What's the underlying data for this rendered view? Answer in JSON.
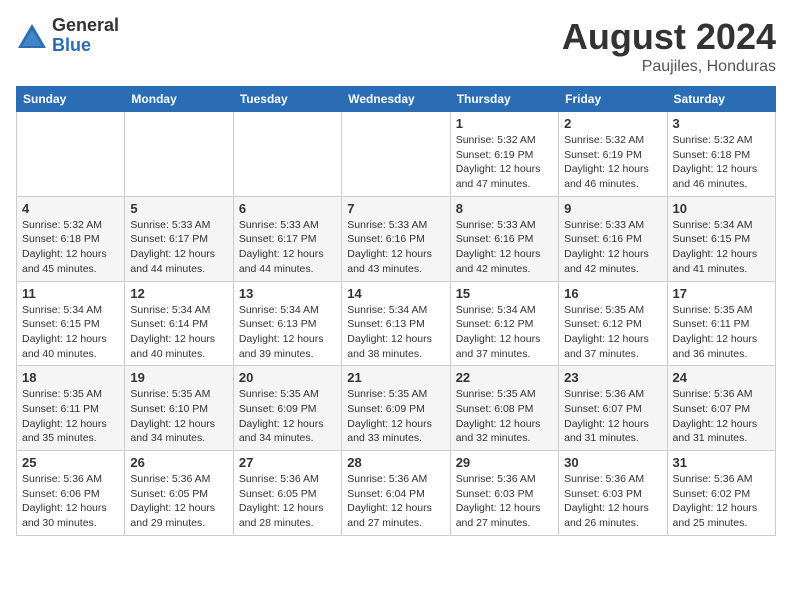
{
  "logo": {
    "general": "General",
    "blue": "Blue"
  },
  "title": {
    "month": "August 2024",
    "location": "Paujiles, Honduras"
  },
  "weekdays": [
    "Sunday",
    "Monday",
    "Tuesday",
    "Wednesday",
    "Thursday",
    "Friday",
    "Saturday"
  ],
  "weeks": [
    [
      {
        "day": "",
        "info": ""
      },
      {
        "day": "",
        "info": ""
      },
      {
        "day": "",
        "info": ""
      },
      {
        "day": "",
        "info": ""
      },
      {
        "day": "1",
        "info": "Sunrise: 5:32 AM\nSunset: 6:19 PM\nDaylight: 12 hours\nand 47 minutes."
      },
      {
        "day": "2",
        "info": "Sunrise: 5:32 AM\nSunset: 6:19 PM\nDaylight: 12 hours\nand 46 minutes."
      },
      {
        "day": "3",
        "info": "Sunrise: 5:32 AM\nSunset: 6:18 PM\nDaylight: 12 hours\nand 46 minutes."
      }
    ],
    [
      {
        "day": "4",
        "info": "Sunrise: 5:32 AM\nSunset: 6:18 PM\nDaylight: 12 hours\nand 45 minutes."
      },
      {
        "day": "5",
        "info": "Sunrise: 5:33 AM\nSunset: 6:17 PM\nDaylight: 12 hours\nand 44 minutes."
      },
      {
        "day": "6",
        "info": "Sunrise: 5:33 AM\nSunset: 6:17 PM\nDaylight: 12 hours\nand 44 minutes."
      },
      {
        "day": "7",
        "info": "Sunrise: 5:33 AM\nSunset: 6:16 PM\nDaylight: 12 hours\nand 43 minutes."
      },
      {
        "day": "8",
        "info": "Sunrise: 5:33 AM\nSunset: 6:16 PM\nDaylight: 12 hours\nand 42 minutes."
      },
      {
        "day": "9",
        "info": "Sunrise: 5:33 AM\nSunset: 6:16 PM\nDaylight: 12 hours\nand 42 minutes."
      },
      {
        "day": "10",
        "info": "Sunrise: 5:34 AM\nSunset: 6:15 PM\nDaylight: 12 hours\nand 41 minutes."
      }
    ],
    [
      {
        "day": "11",
        "info": "Sunrise: 5:34 AM\nSunset: 6:15 PM\nDaylight: 12 hours\nand 40 minutes."
      },
      {
        "day": "12",
        "info": "Sunrise: 5:34 AM\nSunset: 6:14 PM\nDaylight: 12 hours\nand 40 minutes."
      },
      {
        "day": "13",
        "info": "Sunrise: 5:34 AM\nSunset: 6:13 PM\nDaylight: 12 hours\nand 39 minutes."
      },
      {
        "day": "14",
        "info": "Sunrise: 5:34 AM\nSunset: 6:13 PM\nDaylight: 12 hours\nand 38 minutes."
      },
      {
        "day": "15",
        "info": "Sunrise: 5:34 AM\nSunset: 6:12 PM\nDaylight: 12 hours\nand 37 minutes."
      },
      {
        "day": "16",
        "info": "Sunrise: 5:35 AM\nSunset: 6:12 PM\nDaylight: 12 hours\nand 37 minutes."
      },
      {
        "day": "17",
        "info": "Sunrise: 5:35 AM\nSunset: 6:11 PM\nDaylight: 12 hours\nand 36 minutes."
      }
    ],
    [
      {
        "day": "18",
        "info": "Sunrise: 5:35 AM\nSunset: 6:11 PM\nDaylight: 12 hours\nand 35 minutes."
      },
      {
        "day": "19",
        "info": "Sunrise: 5:35 AM\nSunset: 6:10 PM\nDaylight: 12 hours\nand 34 minutes."
      },
      {
        "day": "20",
        "info": "Sunrise: 5:35 AM\nSunset: 6:09 PM\nDaylight: 12 hours\nand 34 minutes."
      },
      {
        "day": "21",
        "info": "Sunrise: 5:35 AM\nSunset: 6:09 PM\nDaylight: 12 hours\nand 33 minutes."
      },
      {
        "day": "22",
        "info": "Sunrise: 5:35 AM\nSunset: 6:08 PM\nDaylight: 12 hours\nand 32 minutes."
      },
      {
        "day": "23",
        "info": "Sunrise: 5:36 AM\nSunset: 6:07 PM\nDaylight: 12 hours\nand 31 minutes."
      },
      {
        "day": "24",
        "info": "Sunrise: 5:36 AM\nSunset: 6:07 PM\nDaylight: 12 hours\nand 31 minutes."
      }
    ],
    [
      {
        "day": "25",
        "info": "Sunrise: 5:36 AM\nSunset: 6:06 PM\nDaylight: 12 hours\nand 30 minutes."
      },
      {
        "day": "26",
        "info": "Sunrise: 5:36 AM\nSunset: 6:05 PM\nDaylight: 12 hours\nand 29 minutes."
      },
      {
        "day": "27",
        "info": "Sunrise: 5:36 AM\nSunset: 6:05 PM\nDaylight: 12 hours\nand 28 minutes."
      },
      {
        "day": "28",
        "info": "Sunrise: 5:36 AM\nSunset: 6:04 PM\nDaylight: 12 hours\nand 27 minutes."
      },
      {
        "day": "29",
        "info": "Sunrise: 5:36 AM\nSunset: 6:03 PM\nDaylight: 12 hours\nand 27 minutes."
      },
      {
        "day": "30",
        "info": "Sunrise: 5:36 AM\nSunset: 6:03 PM\nDaylight: 12 hours\nand 26 minutes."
      },
      {
        "day": "31",
        "info": "Sunrise: 5:36 AM\nSunset: 6:02 PM\nDaylight: 12 hours\nand 25 minutes."
      }
    ]
  ]
}
